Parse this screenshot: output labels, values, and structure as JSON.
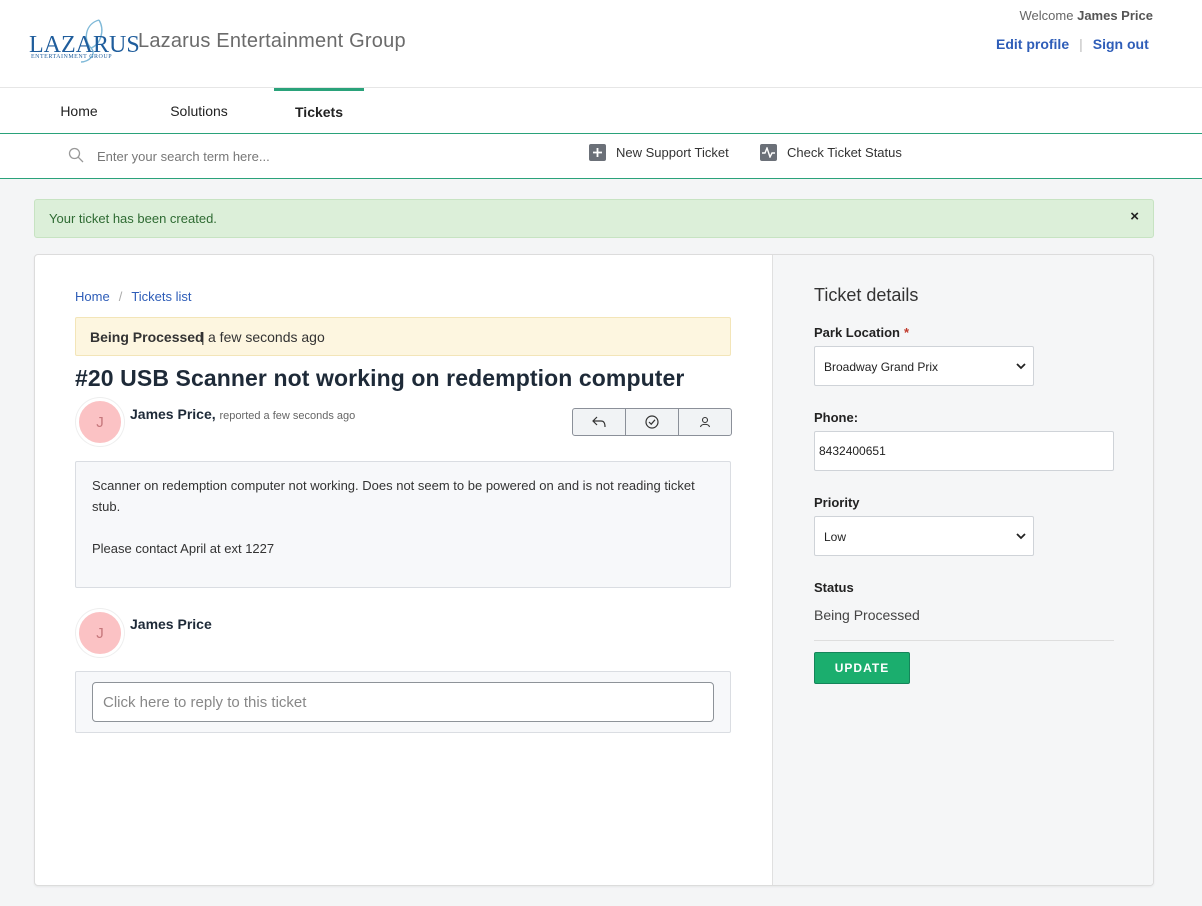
{
  "brand": {
    "logo_text": "LAZARUS",
    "logo_sub": "ENTERTAINMENT GROUP",
    "company_name": "Lazarus Entertainment Group"
  },
  "user": {
    "welcome_prefix": "Welcome",
    "name": "James Price",
    "edit_profile": "Edit profile",
    "sign_out": "Sign out"
  },
  "nav": {
    "tabs": [
      {
        "label": "Home",
        "active": false
      },
      {
        "label": "Solutions",
        "active": false
      },
      {
        "label": "Tickets",
        "active": true
      }
    ]
  },
  "search": {
    "placeholder": "Enter your search term here...",
    "new_ticket": "New Support Ticket",
    "check_status": "Check Ticket Status"
  },
  "alert": {
    "message": "Your ticket has been created.",
    "close": "×"
  },
  "breadcrumb": {
    "home": "Home",
    "separator": "/",
    "tickets_list": "Tickets list"
  },
  "ticket": {
    "status": "Being Processed",
    "separator": "|",
    "time": "a few seconds ago",
    "title": "#20 USB Scanner not working on redemption computer",
    "author": "James Price,",
    "author_meta": "reported a few seconds ago",
    "avatar_initial": "J",
    "body_line1": "Scanner on redemption computer not working. Does not seem to be powered on and is not reading ticket stub.",
    "body_line2": "Please contact April at ext 1227"
  },
  "reply": {
    "author": "James Price",
    "avatar_initial": "J",
    "placeholder": "Click here to reply to this ticket"
  },
  "details": {
    "title": "Ticket details",
    "park_location_label": "Park Location",
    "required_mark": "*",
    "park_location_value": "Broadway Grand Prix",
    "phone_label": "Phone:",
    "phone_value": "8432400651",
    "priority_label": "Priority",
    "priority_value": "Low",
    "status_label": "Status",
    "status_value": "Being Processed",
    "update_button": "UPDATE"
  },
  "colors": {
    "accent_green": "#1bae6e",
    "link_blue": "#2e5db8",
    "alert_bg": "#dcefd9",
    "status_bg": "#fdf6e0"
  }
}
